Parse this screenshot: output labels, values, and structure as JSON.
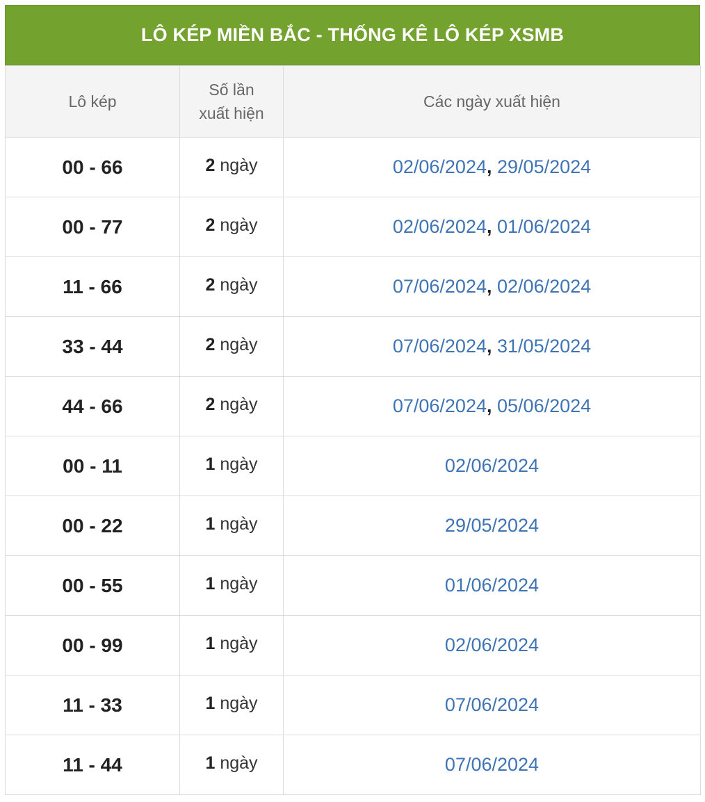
{
  "title": "LÔ KÉP MIỀN BẮC - THỐNG KÊ LÔ KÉP XSMB",
  "headers": {
    "col1": "Lô kép",
    "col2": "Số lần xuất hiện",
    "col3": "Các ngày xuất hiện"
  },
  "unit": "ngày",
  "separator": ",",
  "colors": {
    "header_bg": "#74a22f",
    "link": "#3f74b4"
  },
  "rows": [
    {
      "pair": "00 - 66",
      "count": "2",
      "dates": [
        "02/06/2024",
        "29/05/2024"
      ]
    },
    {
      "pair": "00 - 77",
      "count": "2",
      "dates": [
        "02/06/2024",
        "01/06/2024"
      ]
    },
    {
      "pair": "11 - 66",
      "count": "2",
      "dates": [
        "07/06/2024",
        "02/06/2024"
      ]
    },
    {
      "pair": "33 - 44",
      "count": "2",
      "dates": [
        "07/06/2024",
        "31/05/2024"
      ]
    },
    {
      "pair": "44 - 66",
      "count": "2",
      "dates": [
        "07/06/2024",
        "05/06/2024"
      ]
    },
    {
      "pair": "00 - 11",
      "count": "1",
      "dates": [
        "02/06/2024"
      ]
    },
    {
      "pair": "00 - 22",
      "count": "1",
      "dates": [
        "29/05/2024"
      ]
    },
    {
      "pair": "00 - 55",
      "count": "1",
      "dates": [
        "01/06/2024"
      ]
    },
    {
      "pair": "00 - 99",
      "count": "1",
      "dates": [
        "02/06/2024"
      ]
    },
    {
      "pair": "11 - 33",
      "count": "1",
      "dates": [
        "07/06/2024"
      ]
    },
    {
      "pair": "11 - 44",
      "count": "1",
      "dates": [
        "07/06/2024"
      ]
    }
  ]
}
